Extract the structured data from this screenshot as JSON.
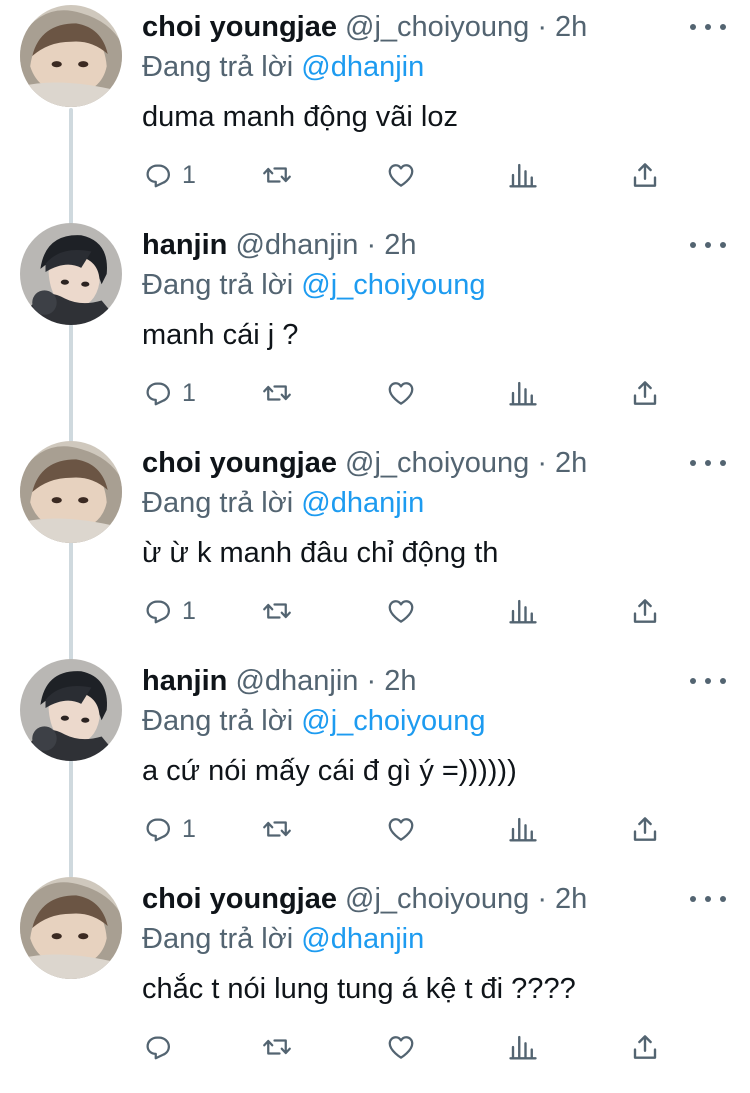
{
  "colors": {
    "text": "#0f1419",
    "muted": "#536471",
    "link": "#1d9bf0",
    "thread_line": "#cfd9de"
  },
  "tweets": [
    {
      "name": "choi youngjae",
      "handle": "@j_choiyoung",
      "time": "· 2h",
      "replying_prefix": "Đang trả lời",
      "replying_to": "@dhanjin",
      "text": "duma manh động vãi loz",
      "reply_count": "1",
      "avatar_icon": "avatar-choi-youngjae"
    },
    {
      "name": "hanjin",
      "handle": "@dhanjin",
      "time": "· 2h",
      "replying_prefix": "Đang trả lời",
      "replying_to": "@j_choiyoung",
      "text": "manh cái j ?",
      "reply_count": "1",
      "avatar_icon": "avatar-hanjin"
    },
    {
      "name": "choi youngjae",
      "handle": "@j_choiyoung",
      "time": "· 2h",
      "replying_prefix": "Đang trả lời",
      "replying_to": "@dhanjin",
      "text": "ừ ừ k manh đâu chỉ động th",
      "reply_count": "1",
      "avatar_icon": "avatar-choi-youngjae"
    },
    {
      "name": "hanjin",
      "handle": "@dhanjin",
      "time": "· 2h",
      "replying_prefix": "Đang trả lời",
      "replying_to": "@j_choiyoung",
      "text": "a cứ nói mấy cái đ gì ý =))))))",
      "reply_count": "1",
      "avatar_icon": "avatar-hanjin"
    },
    {
      "name": "choi youngjae",
      "handle": "@j_choiyoung",
      "time": "· 2h",
      "replying_prefix": "Đang trả lời",
      "replying_to": "@dhanjin",
      "text": "chắc t nói lung tung á kệ t đi ????",
      "reply_count": "",
      "avatar_icon": "avatar-choi-youngjae"
    }
  ]
}
